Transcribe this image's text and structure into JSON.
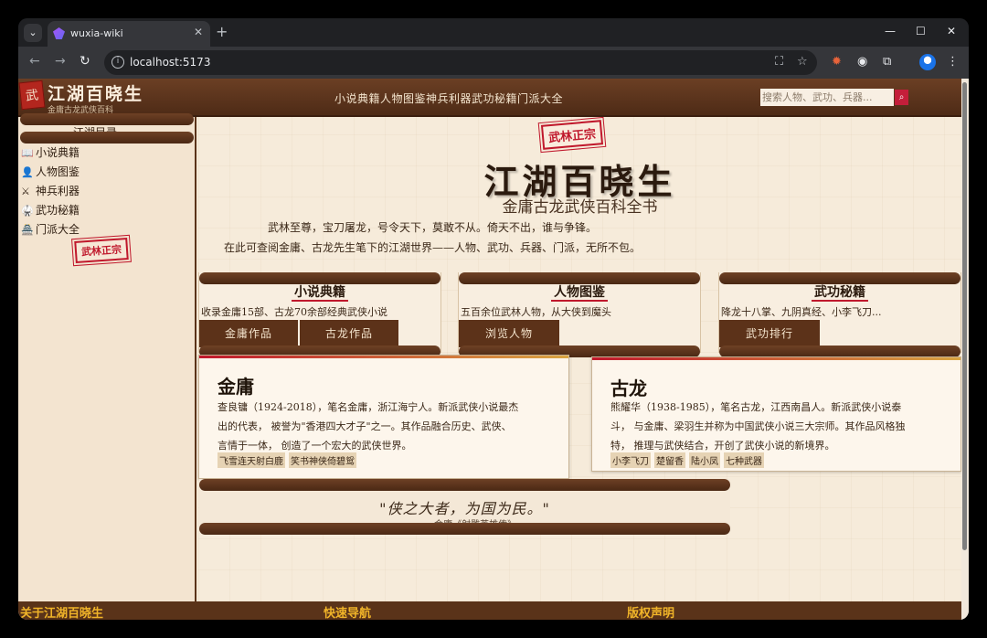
{
  "browser": {
    "tab_title": "wuxia-wiki",
    "url": "localhost:5173"
  },
  "header": {
    "seal": "武",
    "title": "江湖百晓生",
    "subtitle": "金庸古龙武侠百科",
    "nav": "小说典籍人物图鉴神兵利器武功秘籍门派大全",
    "search_placeholder": "搜索人物、武功、兵器...",
    "search_icon": "search-icon"
  },
  "sidebar": {
    "title": "江湖目录",
    "items": [
      {
        "icon": "book-icon",
        "glyph": "📖",
        "label": "小说典籍"
      },
      {
        "icon": "person-icon",
        "glyph": "👤",
        "label": "人物图鉴"
      },
      {
        "icon": "swords-icon",
        "glyph": "⚔",
        "label": "神兵利器"
      },
      {
        "icon": "martial-arts-icon",
        "glyph": "🥋",
        "label": "武功秘籍"
      },
      {
        "icon": "temple-icon",
        "glyph": "🏯",
        "label": "门派大全"
      }
    ],
    "stamp": "武林正宗"
  },
  "hero": {
    "stamp": "武林正宗",
    "title": "江湖百晓生",
    "subtitle": "金庸古龙武侠百科全书",
    "desc_line1": "武林至尊，宝刀屠龙，号令天下，莫敢不从。倚天不出，谁与争锋。",
    "desc_line2": "在此可查阅金庸、古龙先生笔下的江湖世界——人物、武功、兵器、门派，无所不包。"
  },
  "cards": [
    {
      "title": "小说典籍",
      "desc": "收录金庸15部、古龙70余部经典武侠小说",
      "buttons": [
        "金庸作品",
        "古龙作品"
      ]
    },
    {
      "title": "人物图鉴",
      "desc": "五百余位武林人物，从大侠到魔头",
      "buttons": [
        "浏览人物"
      ]
    },
    {
      "title": "武功秘籍",
      "desc": "降龙十八掌、九阴真经、小李飞刀...",
      "buttons": [
        "武功排行"
      ]
    }
  ],
  "authors": [
    {
      "name": "金庸",
      "bio": [
        "查良镛（1924-2018），笔名金庸，浙江海宁人。新派武侠小说最杰",
        "出的代表，  被誉为\"香港四大才子\"之一。其作品融合历史、武侠、",
        "言情于一体，  创造了一个宏大的武侠世界。"
      ],
      "tags": [
        "飞雪连天射白鹿",
        "笑书神侠倚碧鸳"
      ]
    },
    {
      "name": "古龙",
      "bio": [
        "熊耀华（1938-1985），笔名古龙，江西南昌人。新派武侠小说泰",
        "斗，  与金庸、梁羽生并称为中国武侠小说三大宗师。其作品风格独",
        "特，  推理与武侠结合，开创了武侠小说的新境界。"
      ],
      "tags": [
        "小李飞刀",
        "楚留香",
        "陆小凤",
        "七种武器"
      ]
    }
  ],
  "quote": {
    "text": "\"侠之大者，为国为民。\"",
    "cite": "—— 金庸《射雕英雄传》"
  },
  "footer": {
    "about": "关于江湖百晓生",
    "quick_nav": "快速导航",
    "copyright": "版权声明"
  }
}
